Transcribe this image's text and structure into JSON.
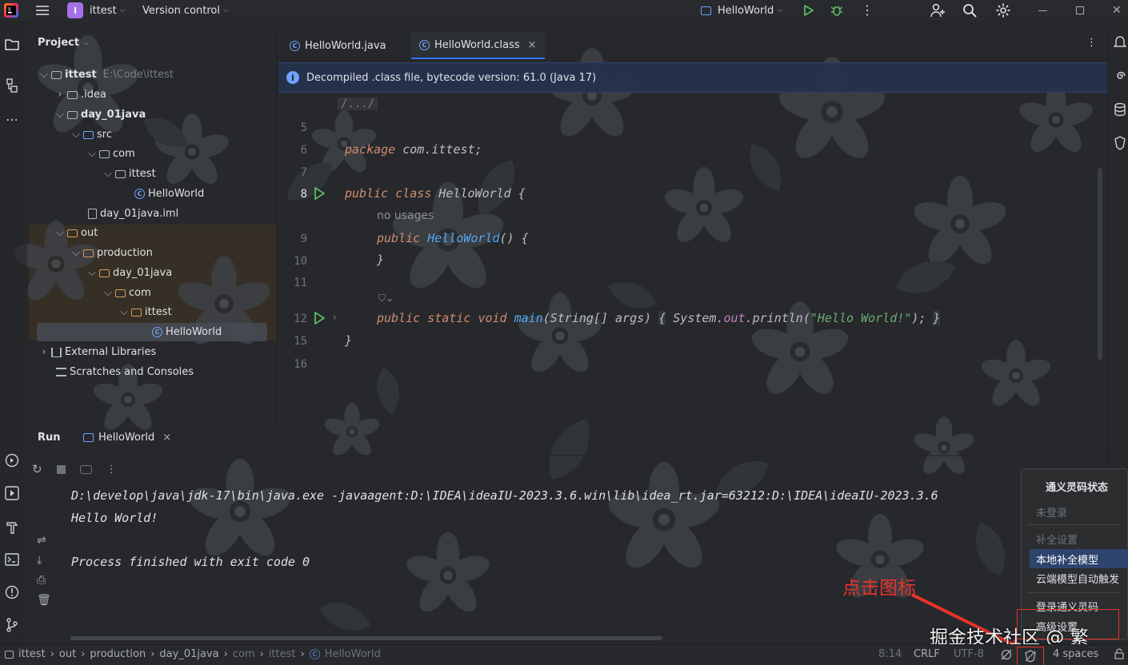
{
  "titlebar": {
    "project_badge": "I",
    "project_name": "ittest",
    "vcs": "Version control",
    "run_config": "HelloWorld"
  },
  "project_panel": {
    "title": "Project",
    "tree": [
      {
        "label": "ittest",
        "suffix": "E:\\Code\\ittest"
      },
      {
        "label": ".idea"
      },
      {
        "label": "day_01java"
      },
      {
        "label": "src"
      },
      {
        "label": "com"
      },
      {
        "label": "ittest"
      },
      {
        "label": "HelloWorld"
      },
      {
        "label": "day_01java.iml"
      },
      {
        "label": "out"
      },
      {
        "label": "production"
      },
      {
        "label": "day_01java"
      },
      {
        "label": "com"
      },
      {
        "label": "ittest"
      },
      {
        "label": "HelloWorld"
      },
      {
        "label": "External Libraries"
      },
      {
        "label": "Scratches and Consoles"
      }
    ]
  },
  "editor": {
    "tabs": [
      {
        "label": "HelloWorld.java"
      },
      {
        "label": "HelloWorld.class",
        "close": "×"
      }
    ],
    "banner": "Decompiled .class file, bytecode version: 61.0 (Java 17)",
    "fold_comment": "/.../",
    "line_numbers": [
      "5",
      "6",
      "7",
      "8",
      "9",
      "10",
      "11",
      "12",
      "15",
      "16"
    ],
    "hint_no_usages": "no usages",
    "code": {
      "kw_package": "package",
      "pkg_name": " com.ittest;",
      "kw_public": "public",
      "kw_class": "class",
      "class_name": "HelloWorld",
      "brace_open": "{",
      "ctor_name": "HelloWorld",
      "ctor_rest": "() {",
      "brace_close": "}",
      "kw_static": "static",
      "kw_void": "void",
      "main_name": "main",
      "main_args": "(String[] args)",
      "fold_open": "{",
      "sys": "System.",
      "out": "out",
      "println": ".println(",
      "string": "\"Hello World!\"",
      "stmt_end": ");",
      "fold_close": "}",
      "class_close": "}"
    }
  },
  "run_panel": {
    "title": "Run",
    "tab": "HelloWorld",
    "close": "×",
    "console": [
      "D:\\develop\\java\\jdk-17\\bin\\java.exe -javaagent:D:\\IDEA\\ideaIU-2023.3.6.win\\lib\\idea_rt.jar=63212:D:\\IDEA\\ideaIU-2023.3.6",
      "Hello World!",
      "Process finished with exit code 0"
    ]
  },
  "popup": {
    "title": "通义灵码状态",
    "items": [
      "未登录",
      "补全设置",
      "本地补全模型",
      "云端模型自动触发",
      "登录通义灵码",
      "高级设置"
    ]
  },
  "annotation": {
    "text": "点击图标",
    "color": "#e8332b"
  },
  "watermark": "掘金技术社区 @ 繁_",
  "statusbar": {
    "breadcrumbs": [
      "ittest",
      "out",
      "production",
      "day_01java",
      "com",
      "ittest",
      "HelloWorld"
    ],
    "position": "8:14",
    "line_sep": "CRLF",
    "encoding": "UTF-8",
    "indent": "4 spaces"
  },
  "colors": {
    "keyword": "#cf8e6d",
    "function": "#56a8f5",
    "string": "#6aab73",
    "field": "#c77dbb",
    "accent": "#3574f0"
  }
}
